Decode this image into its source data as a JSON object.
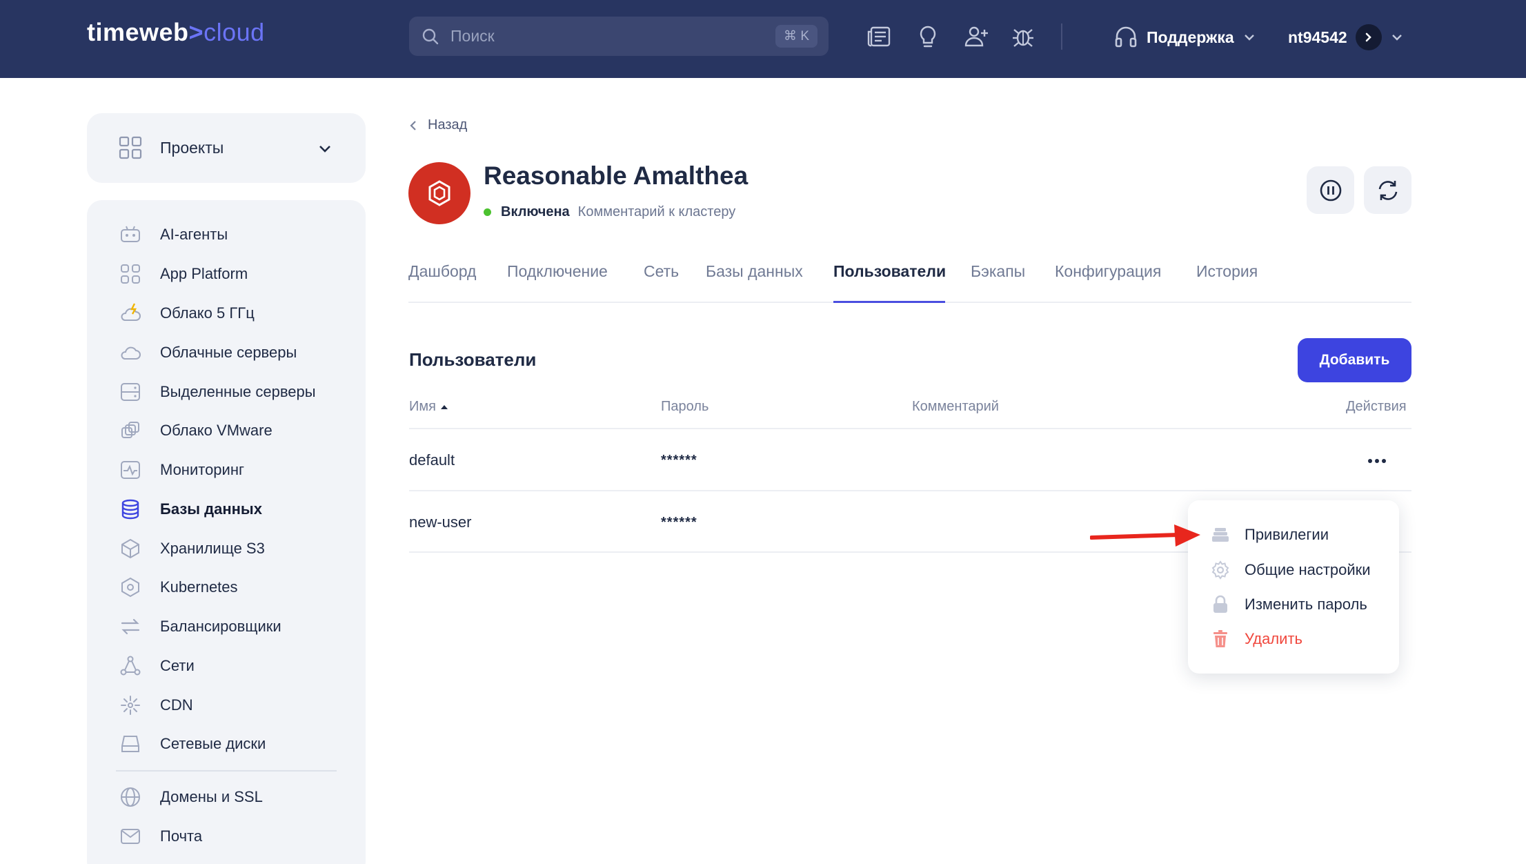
{
  "header": {
    "logo_main": "timeweb",
    "logo_arrow": ">",
    "logo_cloud": "cloud",
    "search_placeholder": "Поиск",
    "search_shortcut": "⌘ K",
    "icons": [
      "news-icon",
      "lightbulb-icon",
      "add-user-icon",
      "bug-icon"
    ],
    "support_label": "Поддержка",
    "username": "nt94542"
  },
  "sidebar": {
    "projects_label": "Проекты",
    "items": [
      {
        "label": "AI-агенты",
        "icon": "robot-icon"
      },
      {
        "label": "App Platform",
        "icon": "apps-grid-icon"
      },
      {
        "label": "Облако 5 ГГц",
        "icon": "cloud-bolt-icon"
      },
      {
        "label": "Облачные серверы",
        "icon": "cloud-icon"
      },
      {
        "label": "Выделенные серверы",
        "icon": "server-icon"
      },
      {
        "label": "Облако VMware",
        "icon": "vmware-icon"
      },
      {
        "label": "Мониторинг",
        "icon": "monitoring-icon"
      },
      {
        "label": "Базы данных",
        "icon": "database-icon",
        "active": true
      },
      {
        "label": "Хранилище S3",
        "icon": "cube-icon"
      },
      {
        "label": "Kubernetes",
        "icon": "kubernetes-icon"
      },
      {
        "label": "Балансировщики",
        "icon": "balancer-icon"
      },
      {
        "label": "Сети",
        "icon": "network-icon"
      },
      {
        "label": "CDN",
        "icon": "cdn-icon"
      },
      {
        "label": "Сетевые диски",
        "icon": "disk-icon"
      },
      {
        "label": "Домены и SSL",
        "icon": "globe-icon"
      },
      {
        "label": "Почта",
        "icon": "mail-icon"
      }
    ]
  },
  "main": {
    "back_label": "Назад",
    "cluster_name": "Reasonable Amalthea",
    "status": "Включена",
    "comment_link": "Комментарий к кластеру",
    "tabs": [
      {
        "label": "Дашборд"
      },
      {
        "label": "Подключение"
      },
      {
        "label": "Сеть"
      },
      {
        "label": "Базы данных"
      },
      {
        "label": "Пользователи",
        "active": true
      },
      {
        "label": "Бэкапы"
      },
      {
        "label": "Конфигурация"
      },
      {
        "label": "История"
      }
    ],
    "section_title": "Пользователи",
    "add_button": "Добавить",
    "columns": {
      "name": "Имя",
      "password": "Пароль",
      "comment": "Комментарий",
      "actions": "Действия"
    },
    "rows": [
      {
        "name": "default",
        "password": "******",
        "comment": ""
      },
      {
        "name": "new-user",
        "password": "******",
        "comment": ""
      }
    ],
    "menu": [
      {
        "label": "Привилегии",
        "icon": "privileges-icon"
      },
      {
        "label": "Общие настройки",
        "icon": "gear-icon"
      },
      {
        "label": "Изменить пароль",
        "icon": "lock-icon"
      },
      {
        "label": "Удалить",
        "icon": "trash-icon",
        "danger": true
      }
    ]
  },
  "colors": {
    "header_bg": "#283561",
    "accent": "#3d44e0",
    "status_on": "#4cc22f",
    "danger": "#f0473d",
    "db_avatar": "#d12f22",
    "annotation": "#e8261d"
  }
}
